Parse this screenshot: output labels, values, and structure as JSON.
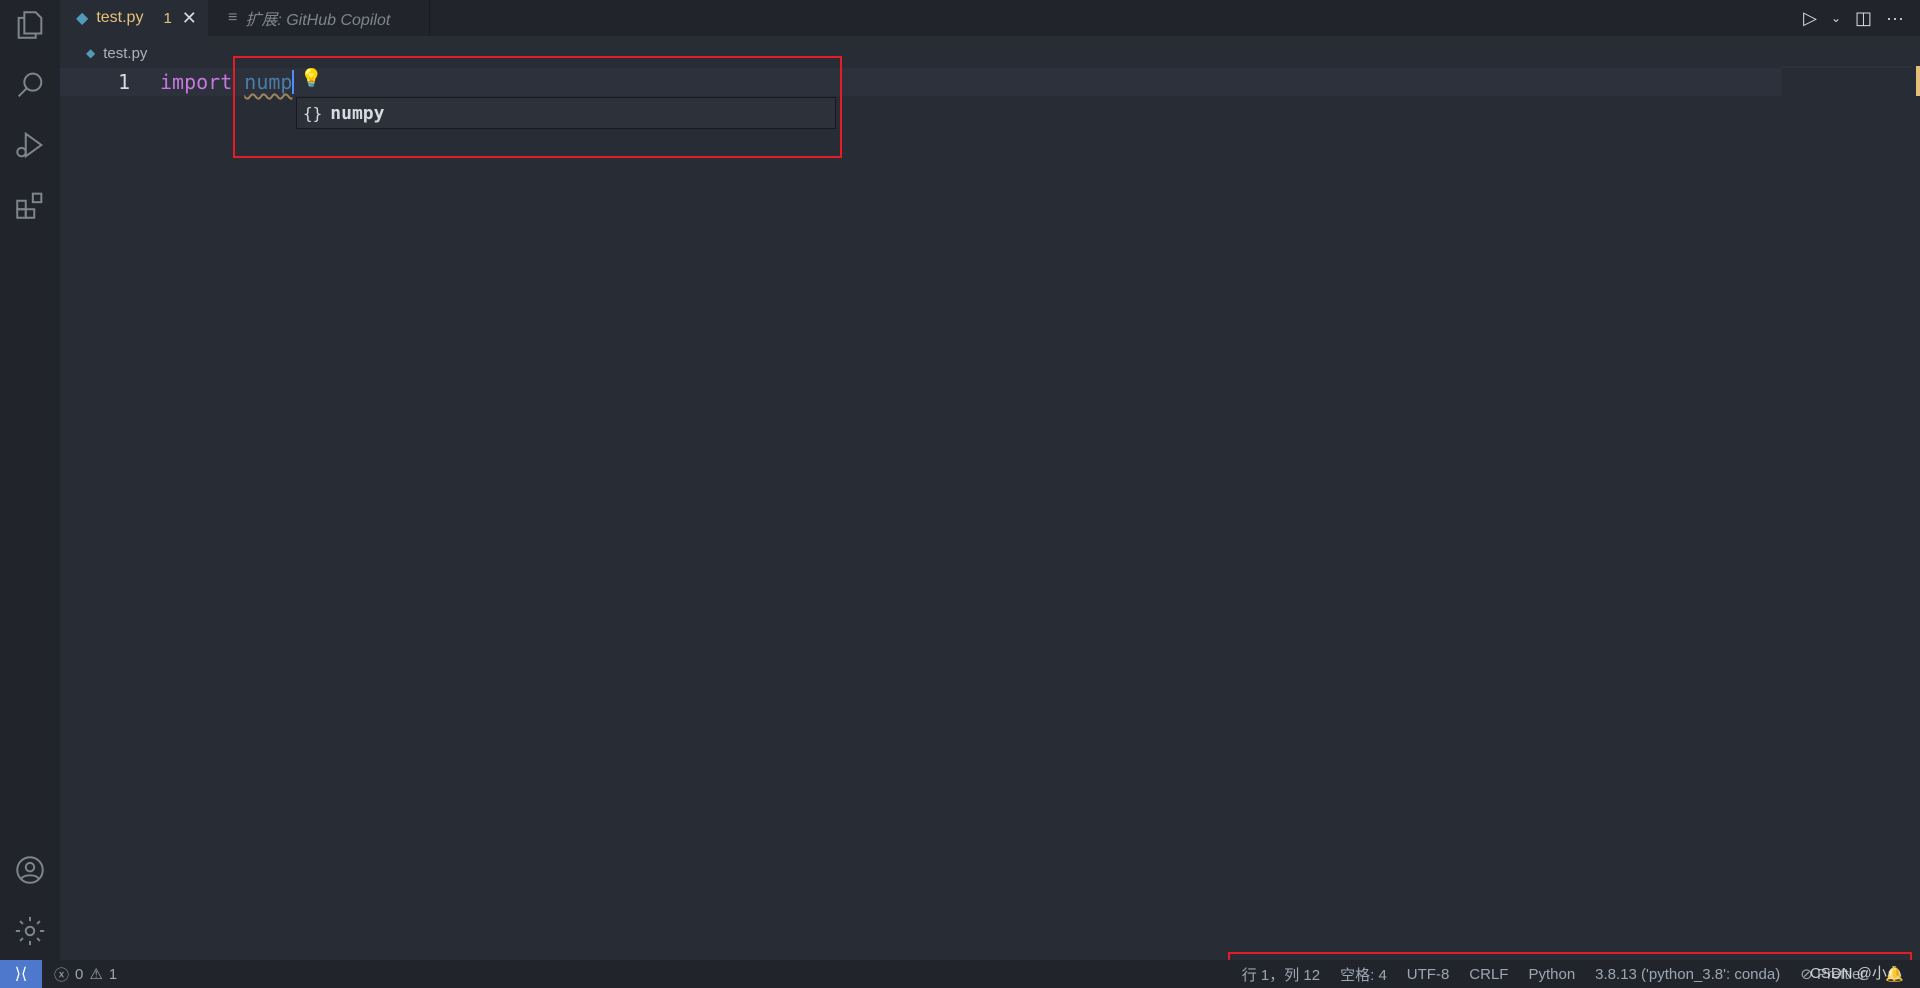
{
  "tabs": [
    {
      "label": "test.py",
      "problems": "1",
      "close": "✕"
    },
    {
      "label": "扩展: GitHub Copilot"
    }
  ],
  "breadcrumb": {
    "file": "test.py"
  },
  "editor": {
    "line_number": "1",
    "keyword": "import",
    "typed": "nump"
  },
  "suggest": {
    "kind_icon": "{}",
    "label": "numpy"
  },
  "statusbar": {
    "errors": "0",
    "warnings": "1",
    "position": "行 1，列 12",
    "spaces": "空格: 4",
    "encoding": "UTF-8",
    "eol": "CRLF",
    "language": "Python",
    "interpreter": "3.8.13 ('python_3.8': conda)",
    "prettier": "Prettier"
  },
  "watermark": "CSDN @小心",
  "colors": {
    "accent": "#4d78cc",
    "highlight_box": "#e51c23",
    "keyword": "#c678dd"
  }
}
